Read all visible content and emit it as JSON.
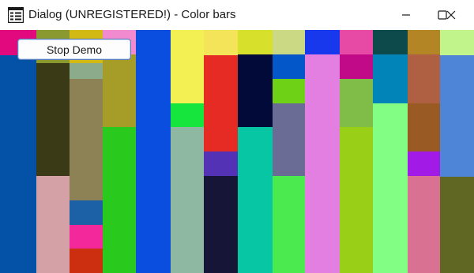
{
  "window": {
    "title": "Dialog (UNREGISTERED!) - Color bars",
    "icon": "dialog-app-icon",
    "controls": {
      "minimize_icon": "minimize-icon",
      "maximize_icon": "maximize-icon",
      "close_icon": "close-icon"
    }
  },
  "demo": {
    "stop_label": "Stop Demo"
  },
  "color_columns": [
    [
      "#e2087e",
      "#0452a7"
    ],
    [
      "#8a9a30",
      "#3a3a17",
      "#d4a1a6"
    ],
    [
      "#d3b913",
      "#8bab8b",
      "#8d8256",
      "#1c60a5",
      "#f2289b",
      "#cb2f10"
    ],
    [
      "#f28ad0",
      "#a69d28",
      "#29c91e"
    ],
    [
      "#0a4ee0"
    ],
    [
      "#f2f052",
      "#16e53e",
      "#8eb8a2"
    ],
    [
      "#f4e45a",
      "#e52b23",
      "#5432b6",
      "#161537"
    ],
    [
      "#d7e02b",
      "#020a3a",
      "#07c6a4"
    ],
    [
      "#cbd884",
      "#0457c8",
      "#6ed116",
      "#6b6c95",
      "#4bea4f"
    ],
    [
      "#1738ec",
      "#e47fe2"
    ],
    [
      "#e64aa4",
      "#c10a88",
      "#80bd48",
      "#9acf17"
    ],
    [
      "#0c4a4b",
      "#0185b9",
      "#81fe83"
    ],
    [
      "#b38525",
      "#b06042",
      "#995a24",
      "#a21ae5",
      "#d87192"
    ],
    [
      "#c2f48c",
      "#4f85d6",
      "#5f6722"
    ]
  ]
}
